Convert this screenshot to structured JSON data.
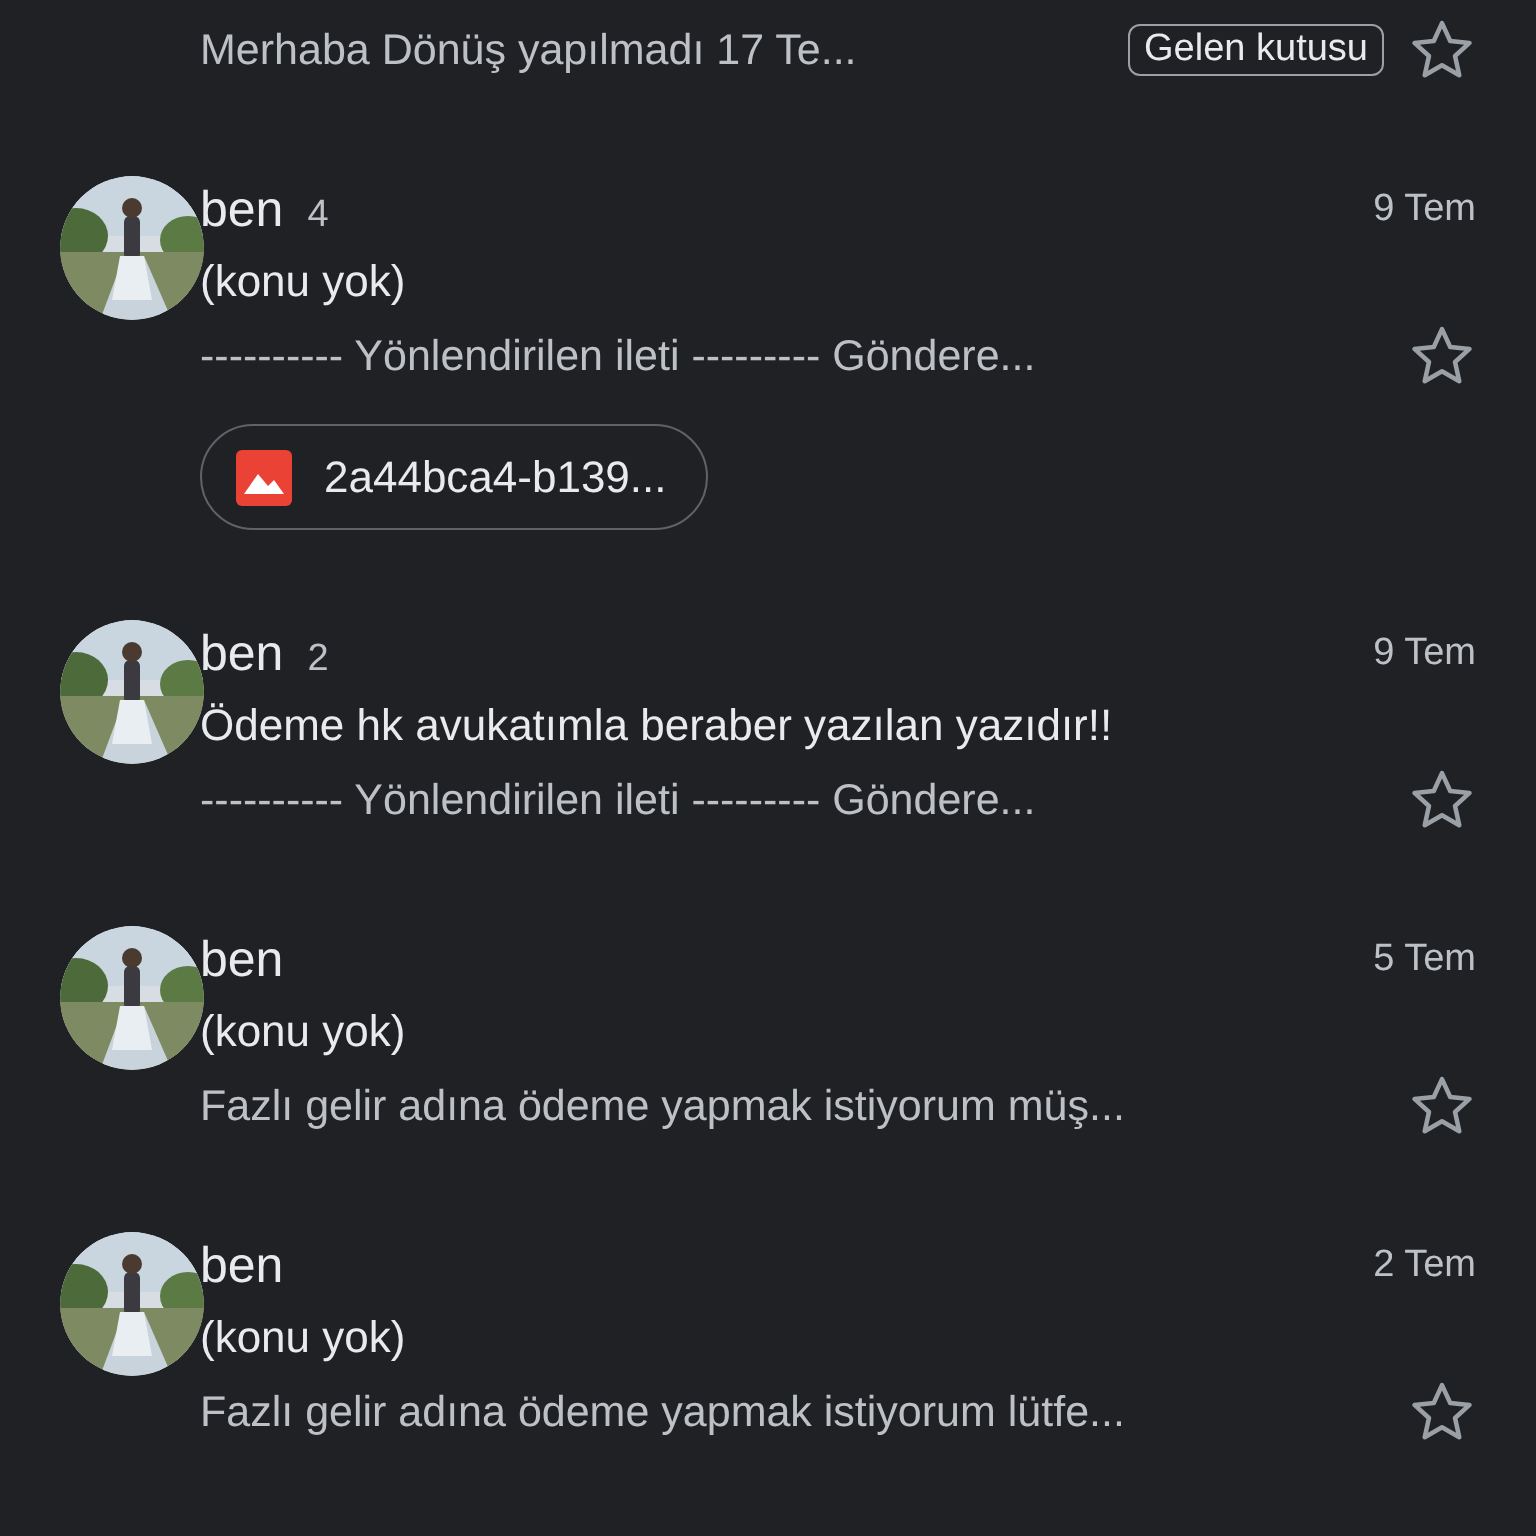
{
  "top_message": {
    "snippet": "Merhaba Dönüş yapılmadı 17 Te...",
    "label": "Gelen kutusu",
    "starred": false
  },
  "messages": [
    {
      "sender": "ben",
      "count": "4",
      "date": "9 Tem",
      "subject": "(konu yok)",
      "snippet": "---------- Yönlendirilen ileti --------- Göndere...",
      "starred": false,
      "attachment": "2a44bca4-b139..."
    },
    {
      "sender": "ben",
      "count": "2",
      "date": "9 Tem",
      "subject": "Ödeme hk avukatımla beraber yazılan yazıdır!!",
      "snippet": "---------- Yönlendirilen ileti --------- Göndere...",
      "starred": false
    },
    {
      "sender": "ben",
      "date": "5 Tem",
      "subject": "(konu yok)",
      "snippet": "Fazlı gelir adına ödeme yapmak istiyorum müş...",
      "starred": false
    },
    {
      "sender": "ben",
      "date": "2 Tem",
      "subject": "(konu yok)",
      "snippet": "Fazlı gelir adına ödeme yapmak istiyorum lütfe...",
      "starred": false
    }
  ]
}
